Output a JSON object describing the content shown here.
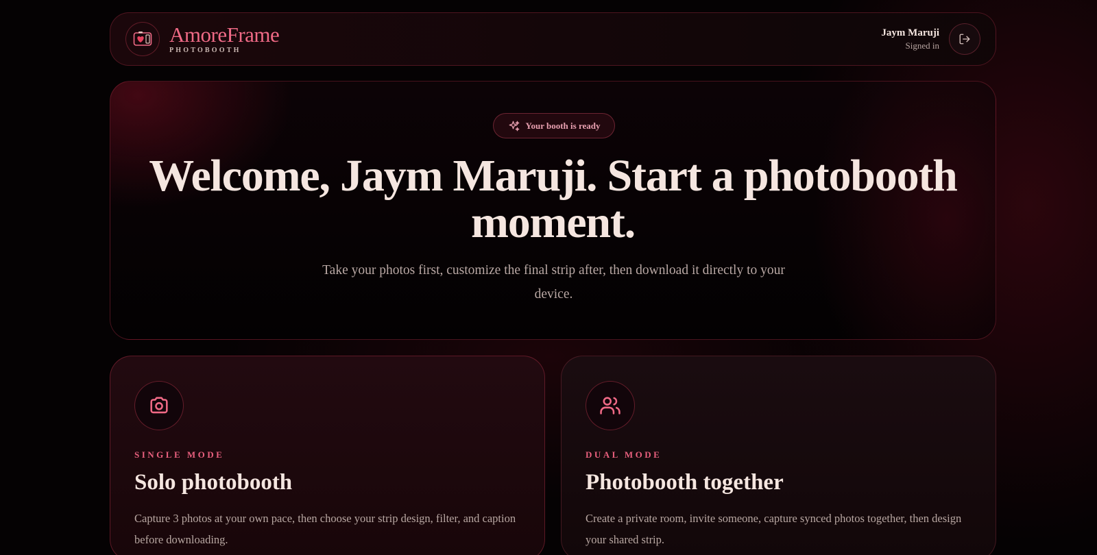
{
  "header": {
    "brand_name": "AmoreFrame",
    "brand_sub": "PHOTOBOOTH",
    "user_name": "Jaym Maruji",
    "user_status": "Signed in",
    "logo_icon": "photobooth-heart-icon",
    "logout_icon": "logout-icon"
  },
  "hero": {
    "badge": "Your booth is ready",
    "badge_icon": "sparkles-icon",
    "title": "Welcome, Jaym Maruji. Start a photobooth moment.",
    "subtitle": "Take your photos first, customize the final strip after, then download it directly to your device."
  },
  "cards": [
    {
      "mode": "SINGLE MODE",
      "title": "Solo photobooth",
      "description": "Capture 3 photos at your own pace, then choose your strip design, filter, and caption before downloading.",
      "icon": "camera-icon"
    },
    {
      "mode": "DUAL MODE",
      "title": "Photobooth together",
      "description": "Create a private room, invite someone, capture synced photos together, then design your shared strip.",
      "icon": "users-icon"
    }
  ],
  "colors": {
    "accent": "#f06a86",
    "background": "#050203",
    "text": "#f5e6e0"
  }
}
